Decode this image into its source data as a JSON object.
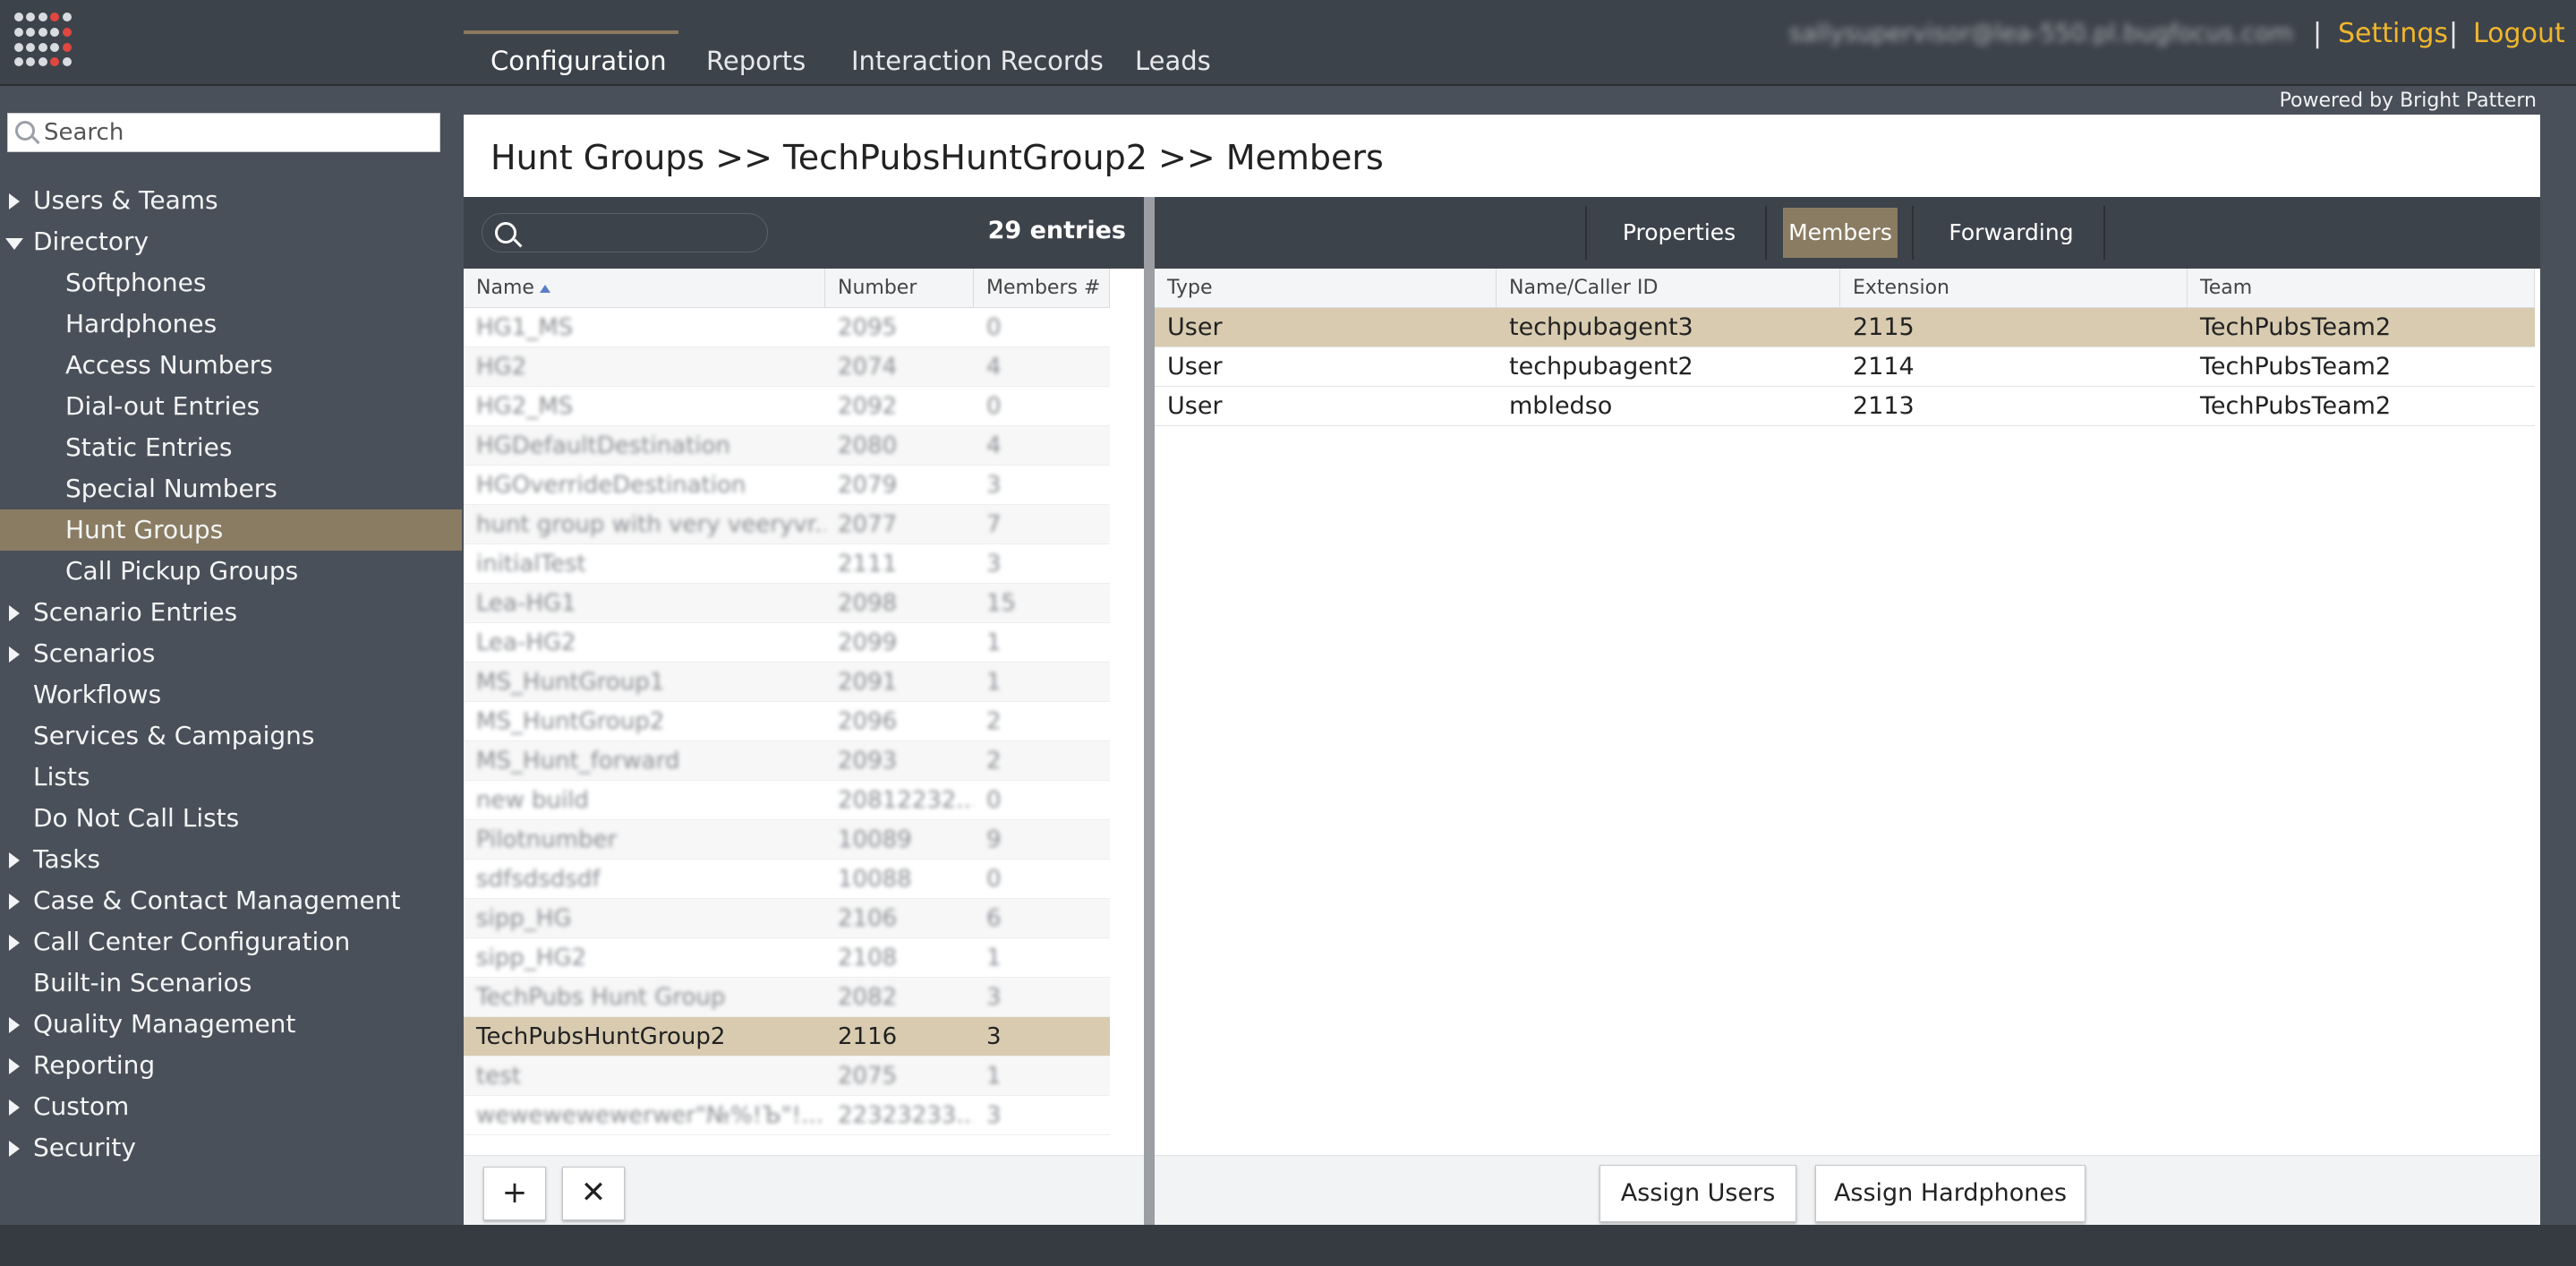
{
  "nav": {
    "tabs": [
      "Configuration",
      "Reports",
      "Interaction Records",
      "Leads"
    ],
    "active": "Configuration",
    "user_email": "sallysupervisor@lea-550.pl.bugfocus.com",
    "separator": "|",
    "settings_label": "Settings",
    "logout_label": "Logout",
    "link_color": "#f0b62c"
  },
  "powered_by": "Powered by Bright Pattern",
  "sidebar": {
    "search_placeholder": "Search",
    "items": [
      {
        "label": "Users & Teams",
        "arrow": "right"
      },
      {
        "label": "Directory",
        "arrow": "down"
      },
      {
        "label": "Softphones",
        "sub": true
      },
      {
        "label": "Hardphones",
        "sub": true
      },
      {
        "label": "Access Numbers",
        "sub": true
      },
      {
        "label": "Dial-out Entries",
        "sub": true
      },
      {
        "label": "Static Entries",
        "sub": true
      },
      {
        "label": "Special Numbers",
        "sub": true
      },
      {
        "label": "Hunt Groups",
        "sub": true,
        "selected": true
      },
      {
        "label": "Call Pickup Groups",
        "sub": true
      },
      {
        "label": "Scenario Entries",
        "arrow": "right"
      },
      {
        "label": "Scenarios",
        "arrow": "right"
      },
      {
        "label": "Workflows"
      },
      {
        "label": "Services & Campaigns"
      },
      {
        "label": "Lists"
      },
      {
        "label": "Do Not Call Lists"
      },
      {
        "label": "Tasks",
        "arrow": "right"
      },
      {
        "label": "Case & Contact Management",
        "arrow": "right"
      },
      {
        "label": "Call Center Configuration",
        "arrow": "right"
      },
      {
        "label": "Built-in Scenarios"
      },
      {
        "label": "Quality Management",
        "arrow": "right"
      },
      {
        "label": "Reporting",
        "arrow": "right"
      },
      {
        "label": "Custom",
        "arrow": "right"
      },
      {
        "label": "Security",
        "arrow": "right"
      }
    ],
    "selected_color": "#8a7c62"
  },
  "main": {
    "title": "Hunt Groups >> TechPubsHuntGroup2 >> Members"
  },
  "list": {
    "entries": "29 entries",
    "columns": [
      "Name",
      "Number",
      "Members #"
    ],
    "rows": [
      {
        "name": "HG1_MS",
        "number": "2095",
        "members": "0"
      },
      {
        "name": "HG2",
        "number": "2074",
        "members": "4"
      },
      {
        "name": "HG2_MS",
        "number": "2092",
        "members": "0"
      },
      {
        "name": "HGDefaultDestination",
        "number": "2080",
        "members": "4"
      },
      {
        "name": "HGOverrideDestination",
        "number": "2079",
        "members": "3"
      },
      {
        "name": "hunt group with very veeryvr...",
        "number": "2077",
        "members": "7"
      },
      {
        "name": "initialTest",
        "number": "2111",
        "members": "3"
      },
      {
        "name": "Lea-HG1",
        "number": "2098",
        "members": "15"
      },
      {
        "name": "Lea-HG2",
        "number": "2099",
        "members": "1"
      },
      {
        "name": "MS_HuntGroup1",
        "number": "2091",
        "members": "1"
      },
      {
        "name": "MS_HuntGroup2",
        "number": "2096",
        "members": "2"
      },
      {
        "name": "MS_Hunt_forward",
        "number": "2093",
        "members": "2"
      },
      {
        "name": "new build",
        "number": "20812232...",
        "members": "0"
      },
      {
        "name": "Pilotnumber",
        "number": "10089",
        "members": "9"
      },
      {
        "name": "sdfsdsdsdf",
        "number": "10088",
        "members": "0"
      },
      {
        "name": "sipp_HG",
        "number": "2106",
        "members": "6"
      },
      {
        "name": "sipp_HG2",
        "number": "2108",
        "members": "1"
      },
      {
        "name": "TechPubs Hunt Group",
        "number": "2082",
        "members": "3"
      },
      {
        "name": "TechPubsHuntGroup2",
        "number": "2116",
        "members": "3",
        "selected": true
      },
      {
        "name": "test",
        "number": "2075",
        "members": "1"
      },
      {
        "name": "wewewewewerwer\"№%!Ъ\"!...",
        "number": "22323233...",
        "members": "3"
      }
    ],
    "add_label": "+",
    "delete_label": "✕"
  },
  "members": {
    "tabs": [
      "Properties",
      "Members",
      "Forwarding"
    ],
    "active_tab": "Members",
    "columns": [
      "Type",
      "Name/Caller ID",
      "Extension",
      "Team"
    ],
    "rows": [
      {
        "type": "User",
        "name": "techpubagent3",
        "extension": "2115",
        "team": "TechPubsTeam2",
        "selected": true
      },
      {
        "type": "User",
        "name": "techpubagent2",
        "extension": "2114",
        "team": "TechPubsTeam2"
      },
      {
        "type": "User",
        "name": "mbledso",
        "extension": "2113",
        "team": "TechPubsTeam2"
      }
    ],
    "assign_users_label": "Assign Users",
    "assign_hardphones_label": "Assign Hardphones"
  }
}
